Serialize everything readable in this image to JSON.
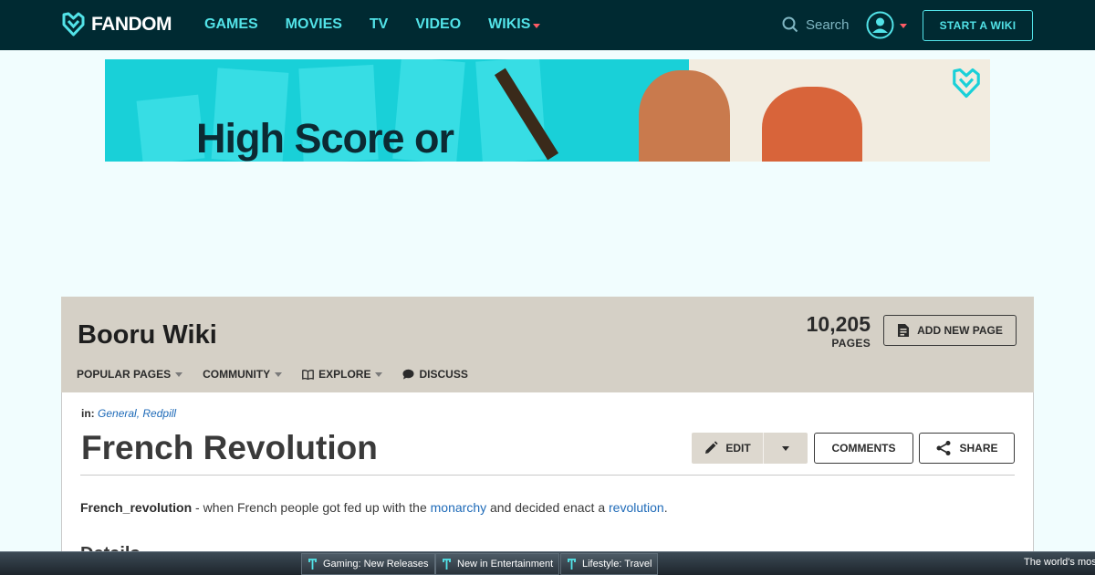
{
  "topnav": {
    "logo_text": "FANDOM",
    "links": [
      {
        "label": "GAMES"
      },
      {
        "label": "MOVIES"
      },
      {
        "label": "TV"
      },
      {
        "label": "VIDEO"
      },
      {
        "label": "WIKIS"
      }
    ],
    "search_label": "Search",
    "start_wiki_label": "START A WIKI",
    "colors": {
      "bg": "#002a32",
      "accent": "#52e3e8",
      "caret": "#ff5b65"
    }
  },
  "ad": {
    "headline": "High Score or",
    "colors": {
      "cyan": "#19d0d8",
      "cream": "#f2ece0"
    }
  },
  "wiki": {
    "title": "Booru Wiki",
    "pages_count": "10,205",
    "pages_label": "PAGES",
    "add_page_label": "ADD NEW PAGE",
    "nav": [
      {
        "label": "POPULAR PAGES",
        "icon": "",
        "has_caret": true
      },
      {
        "label": "COMMUNITY",
        "icon": "",
        "has_caret": true
      },
      {
        "label": "EXPLORE",
        "icon": "book-icon",
        "has_caret": true
      },
      {
        "label": "DISCUSS",
        "icon": "speech-bubble-icon",
        "has_caret": false
      }
    ]
  },
  "article": {
    "categories_label": "in:",
    "categories": [
      "General",
      "Redpill"
    ],
    "title": "French Revolution",
    "edit_label": "EDIT",
    "comments_label": "COMMENTS",
    "share_label": "SHARE",
    "intro": {
      "bold": "French_revolution",
      "text1": " - when French people got fed up with the ",
      "link1": "monarchy",
      "text2": " and decided enact a ",
      "link2": "revolution",
      "text3": "."
    },
    "section_heading": "Details"
  },
  "bottom_bar": {
    "tabs": [
      {
        "label": "Gaming: New Releases"
      },
      {
        "label": "New in Entertainment"
      },
      {
        "label": "Lifestyle: Travel"
      }
    ],
    "right_text": "The world's most"
  }
}
